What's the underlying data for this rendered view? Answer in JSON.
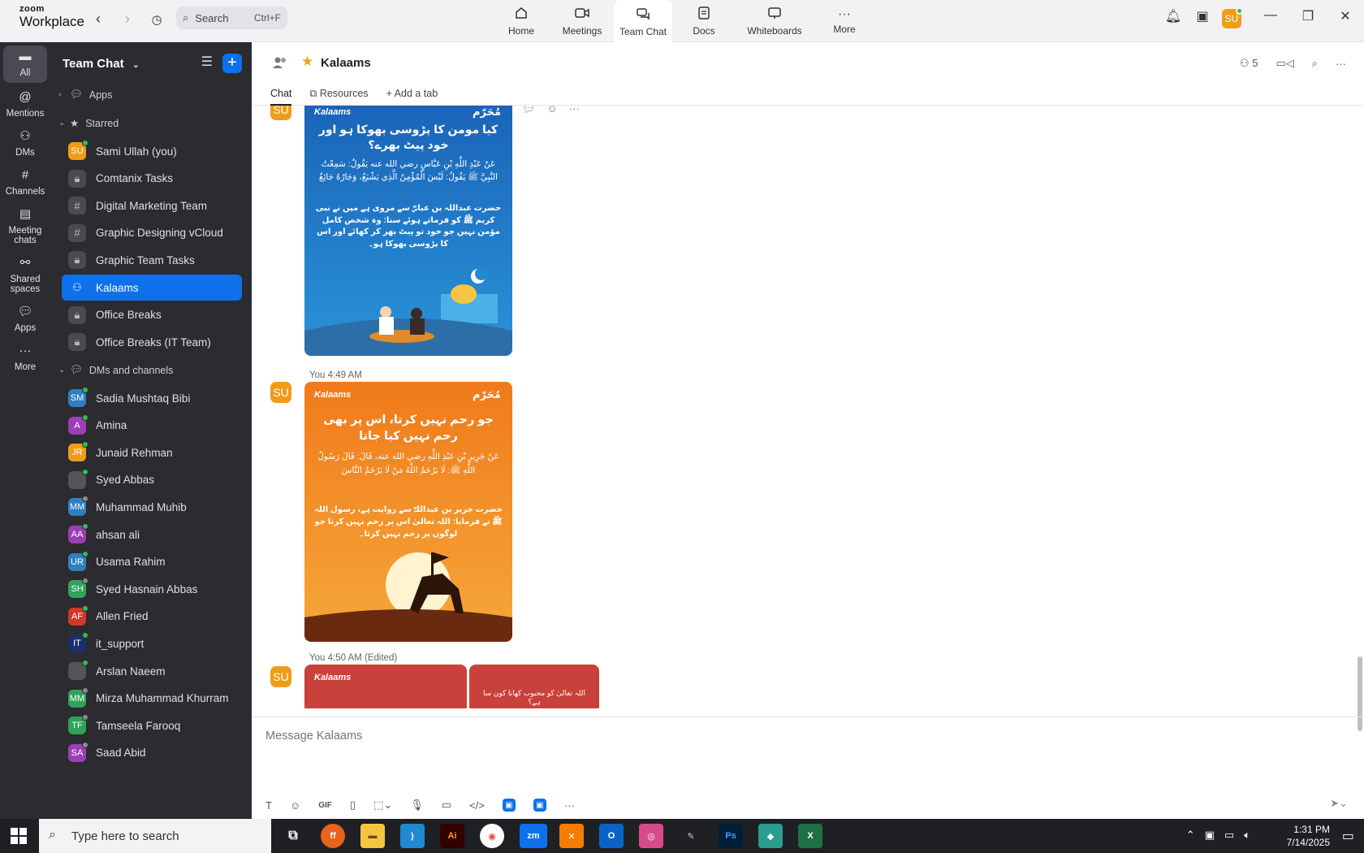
{
  "app": {
    "brand_top": "zoom",
    "brand_bottom": "Workplace",
    "search_placeholder": "Search",
    "search_shortcut": "Ctrl+F"
  },
  "top_nav": [
    {
      "label": "Home",
      "icon": "home-icon"
    },
    {
      "label": "Meetings",
      "icon": "video-icon"
    },
    {
      "label": "Team Chat",
      "icon": "chat-icon",
      "active": true
    },
    {
      "label": "Docs",
      "icon": "doc-icon"
    },
    {
      "label": "Whiteboards",
      "icon": "whiteboard-icon"
    },
    {
      "label": "More",
      "icon": "more-icon"
    }
  ],
  "user_avatar": "SU",
  "rail": [
    {
      "label": "All",
      "active": true
    },
    {
      "label": "Mentions"
    },
    {
      "label": "DMs"
    },
    {
      "label": "Channels"
    },
    {
      "label": "Meeting chats"
    },
    {
      "label": "Shared spaces"
    },
    {
      "label": "Apps"
    },
    {
      "label": "More"
    }
  ],
  "sidebar": {
    "title": "Team Chat",
    "sections": {
      "apps": "Apps",
      "starred": "Starred",
      "dms": "DMs and channels"
    },
    "starred": [
      {
        "label": "Sami Ullah (you)",
        "initials": "SU",
        "color": "#f09c16",
        "kind": "user",
        "online": true
      },
      {
        "label": "Comtanix Tasks",
        "kind": "lock"
      },
      {
        "label": "Digital Marketing Team",
        "kind": "hash"
      },
      {
        "label": "Graphic Designing vCloud",
        "kind": "hash"
      },
      {
        "label": "Graphic Team Tasks",
        "kind": "lock"
      },
      {
        "label": "Kalaams",
        "kind": "group",
        "active": true
      },
      {
        "label": "Office Breaks",
        "kind": "lock"
      },
      {
        "label": "Office Breaks (IT Team)",
        "kind": "lock"
      }
    ],
    "dms": [
      {
        "label": "Sadia Mushtaq Bibi",
        "initials": "SM",
        "color": "#2f7fc1",
        "online": true
      },
      {
        "label": "Amina",
        "initials": "A",
        "color": "#9b3fb4",
        "online": true
      },
      {
        "label": "Junaid Rehman",
        "initials": "JR",
        "color": "#f09c16",
        "online": true
      },
      {
        "label": "Syed Abbas",
        "initials": "",
        "color": "#555",
        "online": true
      },
      {
        "label": "Muhammad Muhib",
        "initials": "MM",
        "color": "#2f7fc1",
        "online": false
      },
      {
        "label": "ahsan ali",
        "initials": "AA",
        "color": "#9b3fb4",
        "online": true
      },
      {
        "label": "Usama Rahim",
        "initials": "UR",
        "color": "#2f7fc1",
        "online": true
      },
      {
        "label": "Syed Hasnain Abbas",
        "initials": "SH",
        "color": "#2fa35a",
        "online": false
      },
      {
        "label": "Allen Fried",
        "initials": "AF",
        "color": "#d0392b",
        "online": true
      },
      {
        "label": "it_support",
        "initials": "IT",
        "color": "#1c2f6b",
        "online": true
      },
      {
        "label": "Arslan Naeem",
        "initials": "",
        "color": "#555",
        "online": true
      },
      {
        "label": "Mirza Muhammad Khurram",
        "initials": "MM",
        "color": "#2fa35a",
        "online": false
      },
      {
        "label": "Tamseela Farooq",
        "initials": "TF",
        "color": "#2fa35a",
        "online": false
      },
      {
        "label": "Saad Abid",
        "initials": "SA",
        "color": "#9b3fb4",
        "online": false
      }
    ]
  },
  "channel": {
    "title": "Kalaams",
    "tabs": [
      "Chat",
      "Resources",
      "Add a tab"
    ],
    "member_count": "5"
  },
  "messages": [
    {
      "meta": "",
      "card": {
        "bg": "#1f78c8",
        "brand": "Kalaams",
        "title": "کیا مومن کا پڑوسی بھوکا ہو اور خود پیٹ بھرے؟",
        "arabic": "عَنْ عَبْدِ اللَّهِ بْنِ عَبَّاسٍ رضي الله عنه يَقُولُ: سَمِعْتُ النَّبِيَّ ﷺ يَقُولُ: لَيْسَ الْمُؤْمِنُ الَّذِي يَشْبَعُ، وَجَارُهُ جَائِعٌ",
        "urdu": "حضرت عبداللہ بن عباسؓ سے مروی ہے میں نے نبی کریم ﷺ کو فرماتے ہوئے سنا: وہ شخص کامل مؤمن نہیں جو خود تو پیٹ بھر کر کھائے اور اس کا پڑوسی بھوکا ہو۔"
      }
    },
    {
      "meta": "You 4:49 AM",
      "card": {
        "bg": "#f08a24",
        "brand": "Kalaams",
        "title": "جو رحم نہیں کرتا، اس پر بھی رحم نہیں کیا جاتا",
        "arabic": "عَنْ جَرِيرِ بْنِ عَبْدِ اللَّهِ رضي الله عنه، قَالَ: قَالَ رَسُولُ اللَّهِ ﷺ: لَا يَرْحَمُ اللَّهُ مَنْ لَا يَرْحَمُ النَّاسَ",
        "urdu": "حضرت جریر بن عبداللہؓ سے روایت ہے، رسول اللہ ﷺ نے فرمایا: اللہ تعالیٰ اس پر رحم نہیں کرتا جو لوگوں پر رحم نہیں کرتا۔"
      }
    },
    {
      "meta": "You 4:50 AM (Edited)",
      "card": {
        "bg": "#c8413a",
        "brand": "Kalaams",
        "title": "اللہ تعالیٰ کو محبوب کھانا کون سا ہے؟"
      }
    }
  ],
  "composer": {
    "placeholder": "Message Kalaams"
  },
  "taskbar": {
    "search_placeholder": "Type here to search",
    "time": "1:31 PM",
    "date": "7/14/2025"
  }
}
